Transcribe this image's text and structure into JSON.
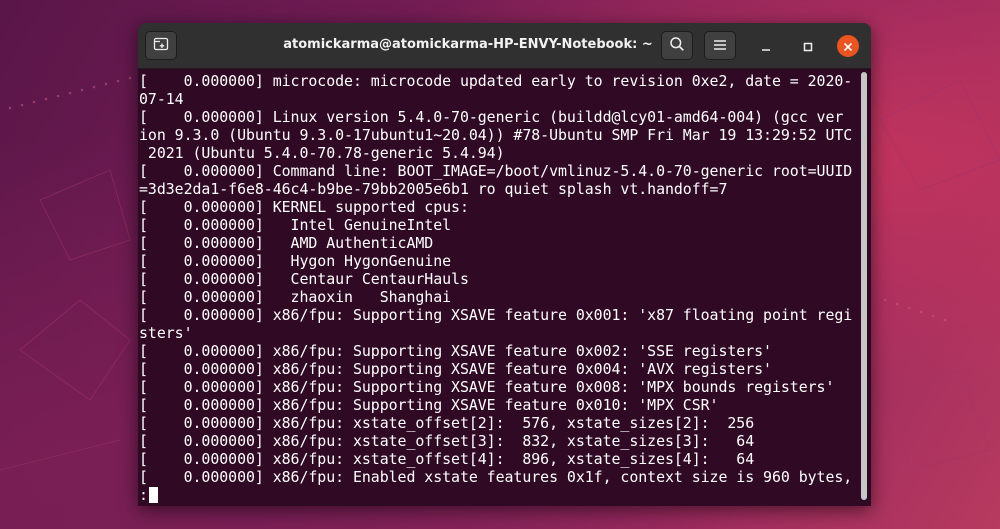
{
  "window": {
    "title": "atomickarma@atomickarma-HP-ENVY-Notebook: ~"
  },
  "terminal": {
    "lines": [
      "[    0.000000] microcode: microcode updated early to revision 0xe2, date = 2020-",
      "07-14",
      "[    0.000000] Linux version 5.4.0-70-generic (buildd@lcy01-amd64-004) (gcc ver",
      "ion 9.3.0 (Ubuntu 9.3.0-17ubuntu1~20.04)) #78-Ubuntu SMP Fri Mar 19 13:29:52 UTC",
      " 2021 (Ubuntu 5.4.0-70.78-generic 5.4.94)",
      "[    0.000000] Command line: BOOT_IMAGE=/boot/vmlinuz-5.4.0-70-generic root=UUID",
      "=3d3e2da1-f6e8-46c4-b9be-79bb2005e6b1 ro quiet splash vt.handoff=7",
      "[    0.000000] KERNEL supported cpus:",
      "[    0.000000]   Intel GenuineIntel",
      "[    0.000000]   AMD AuthenticAMD",
      "[    0.000000]   Hygon HygonGenuine",
      "[    0.000000]   Centaur CentaurHauls",
      "[    0.000000]   zhaoxin   Shanghai",
      "[    0.000000] x86/fpu: Supporting XSAVE feature 0x001: 'x87 floating point regi",
      "sters'",
      "[    0.000000] x86/fpu: Supporting XSAVE feature 0x002: 'SSE registers'",
      "[    0.000000] x86/fpu: Supporting XSAVE feature 0x004: 'AVX registers'",
      "[    0.000000] x86/fpu: Supporting XSAVE feature 0x008: 'MPX bounds registers'",
      "[    0.000000] x86/fpu: Supporting XSAVE feature 0x010: 'MPX CSR'",
      "[    0.000000] x86/fpu: xstate_offset[2]:  576, xstate_sizes[2]:  256",
      "[    0.000000] x86/fpu: xstate_offset[3]:  832, xstate_sizes[3]:   64",
      "[    0.000000] x86/fpu: xstate_offset[4]:  896, xstate_sizes[4]:   64",
      "[    0.000000] x86/fpu: Enabled xstate features 0x1f, context size is 960 bytes,"
    ],
    "prompt": ":"
  },
  "icons": {
    "new_tab": "new-tab-icon",
    "search": "search-icon",
    "menu": "hamburger-menu-icon",
    "minimize": "minimize-icon",
    "maximize": "maximize-icon",
    "close": "close-icon"
  },
  "colors": {
    "terminal_bg": "#300a24",
    "titlebar_bg": "#303030",
    "close_button": "#e95420",
    "text": "#ffffff"
  }
}
